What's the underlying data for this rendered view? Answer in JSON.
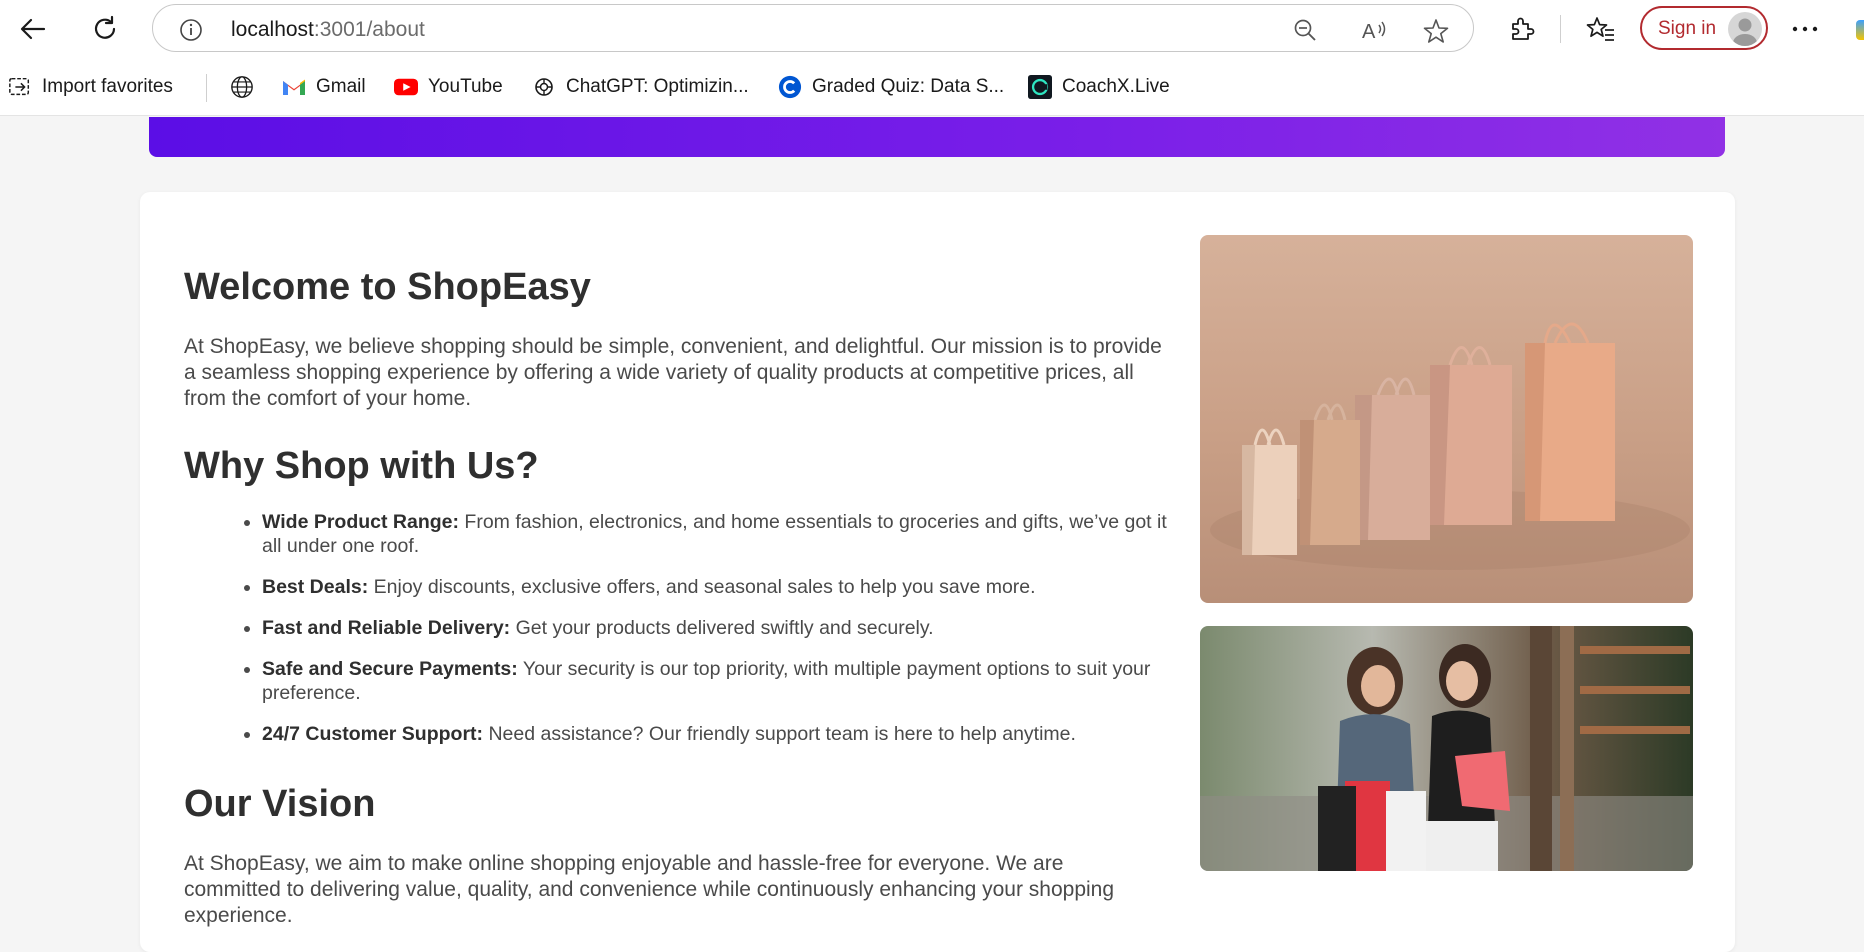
{
  "browser": {
    "url_host": "localhost",
    "url_path": ":3001/about",
    "sign_in_label": "Sign in",
    "icons": [
      "back-icon",
      "refresh-icon",
      "site-info-icon",
      "zoom-out-icon",
      "read-aloud-icon",
      "favorite-star-icon",
      "extensions-icon",
      "favorites-icon",
      "profile-avatar-icon",
      "more-icon"
    ]
  },
  "bookmarks": [
    {
      "label": "Import favorites",
      "icon": "import-icon"
    },
    {
      "label": "",
      "icon": "globe-icon"
    },
    {
      "label": "Gmail",
      "icon": "gmail-icon"
    },
    {
      "label": "YouTube",
      "icon": "youtube-icon"
    },
    {
      "label": "ChatGPT: Optimizin...",
      "icon": "chatgpt-icon"
    },
    {
      "label": "Graded Quiz: Data S...",
      "icon": "coursera-icon"
    },
    {
      "label": "CoachX.Live",
      "icon": "coachx-icon"
    }
  ],
  "page": {
    "welcome_title": "Welcome to ShopEasy",
    "intro": "At ShopEasy, we believe shopping should be simple, convenient, and delightful. Our mission is to provide a seamless shopping experience by offering a wide variety of quality products at competitive prices, all from the comfort of your home.",
    "why_title": "Why Shop with Us?",
    "features": [
      {
        "title": "Wide Product Range:",
        "text": " From fashion, electronics, and home essentials to groceries and gifts, we’ve got it all under one roof."
      },
      {
        "title": "Best Deals:",
        "text": " Enjoy discounts, exclusive offers, and seasonal sales to help you save more."
      },
      {
        "title": "Fast and Reliable Delivery:",
        "text": " Get your products delivered swiftly and securely."
      },
      {
        "title": "Safe and Secure Payments:",
        "text": " Your security is our top priority, with multiple payment options to suit your preference."
      },
      {
        "title": "24/7 Customer Support:",
        "text": " Need assistance? Our friendly support team is here to help anytime."
      }
    ],
    "vision_title": "Our Vision",
    "vision": "At ShopEasy, we aim to make online shopping enjoyable and hassle-free for everyone. We are committed to delivering value, quality, and convenience while continuously enhancing your shopping experience."
  },
  "colors": {
    "accent_start": "#5b0ee6",
    "accent_end": "#9131e5",
    "signin": "#b22a2f"
  }
}
